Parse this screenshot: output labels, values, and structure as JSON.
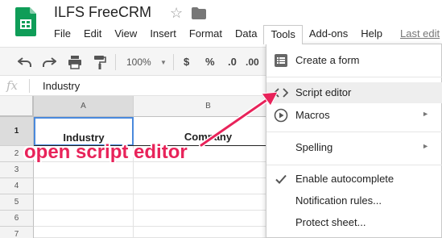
{
  "app": {
    "doc_title": "ILFS FreeCRM"
  },
  "menu": [
    "File",
    "Edit",
    "View",
    "Insert",
    "Format",
    "Data",
    "Tools",
    "Add-ons",
    "Help"
  ],
  "last_edit": "Last edit",
  "toolbar": {
    "zoom": "100%",
    "currency": "$",
    "percent": "%",
    "decimal": ".0",
    "decimal2": ".00"
  },
  "formula": {
    "fx": "fx",
    "value": "Industry"
  },
  "columns": [
    "A",
    "B"
  ],
  "rows": [
    "1",
    "2",
    "3",
    "4",
    "5",
    "6",
    "7"
  ],
  "cells": {
    "a1": "Industry",
    "b1": "Company"
  },
  "tools_menu": {
    "items": [
      {
        "label": "Create a form",
        "icon": "form-icon"
      },
      {
        "label": "Script editor",
        "icon": "code-icon"
      },
      {
        "label": "Macros",
        "icon": "play-icon"
      },
      {
        "label": "Spelling"
      },
      {
        "label": "Enable autocomplete",
        "icon": "check-icon"
      },
      {
        "label": "Notification rules..."
      },
      {
        "label": "Protect sheet..."
      }
    ]
  },
  "annotation": {
    "text": "open script editor",
    "color": "#e8235a"
  },
  "colors": {
    "sheets_green": "#0f9d58",
    "selection_blue": "#4a89dc"
  }
}
